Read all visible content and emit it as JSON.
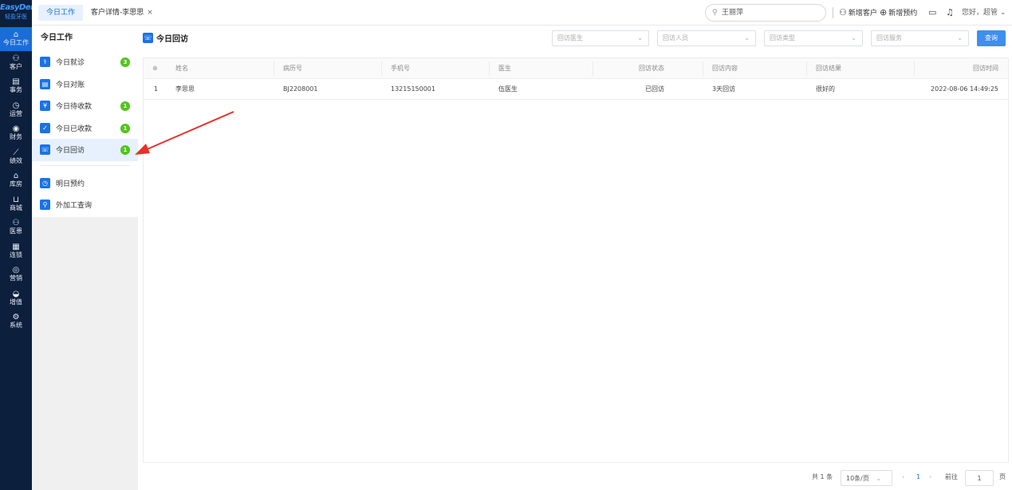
{
  "logo": {
    "brand": "EasyDent",
    "subtitle": "轻盈牙医"
  },
  "nav": [
    {
      "label": "今日工作",
      "icon": "⌂",
      "name": "home-icon",
      "active": true
    },
    {
      "label": "客户",
      "icon": "⚇",
      "name": "person-icon"
    },
    {
      "label": "事务",
      "icon": "▤",
      "name": "task-icon"
    },
    {
      "label": "运营",
      "icon": "◷",
      "name": "clock-icon"
    },
    {
      "label": "财务",
      "icon": "◉",
      "name": "money-icon"
    },
    {
      "label": "绩效",
      "icon": "⟋",
      "name": "chart-icon"
    },
    {
      "label": "库房",
      "icon": "⌂",
      "name": "warehouse-icon"
    },
    {
      "label": "商城",
      "icon": "⊔",
      "name": "cart-icon"
    },
    {
      "label": "医患",
      "icon": "⚇",
      "name": "doctor-patient-icon"
    },
    {
      "label": "连锁",
      "icon": "▦",
      "name": "chain-icon"
    },
    {
      "label": "营销",
      "icon": "◎",
      "name": "marketing-icon"
    },
    {
      "label": "增值",
      "icon": "◒",
      "name": "value-added-icon"
    },
    {
      "label": "系统",
      "icon": "⚙",
      "name": "gear-icon"
    }
  ],
  "topbar": {
    "tabs": [
      {
        "label": "今日工作"
      },
      {
        "label": "客户详情-李思思",
        "close": "×"
      }
    ],
    "search_value": "王丽萍",
    "actions": {
      "new_customer": "新增客户",
      "new_appointment": "新增预约",
      "greeting": "您好，超管"
    }
  },
  "submenu": {
    "title": "今日工作",
    "items": [
      {
        "label": "今日就诊",
        "badge": "3",
        "icon": "⚕",
        "name": "visit-icon"
      },
      {
        "label": "今日对账",
        "badge": "",
        "icon": "▤",
        "name": "ledger-icon"
      },
      {
        "label": "今日待收款",
        "badge": "1",
        "icon": "¥",
        "name": "pending-payment-icon"
      },
      {
        "label": "今日已收款",
        "badge": "1",
        "icon": "✓",
        "name": "received-payment-icon"
      },
      {
        "label": "今日回访",
        "badge": "1",
        "icon": "☏",
        "name": "follow-up-icon",
        "active": true
      }
    ],
    "items2": [
      {
        "label": "明日预约",
        "icon": "◷",
        "name": "appointment-icon"
      },
      {
        "label": "外加工查询",
        "icon": "⚲",
        "name": "outsourcing-icon"
      }
    ]
  },
  "main": {
    "title": "今日回访",
    "filters": {
      "doctor": "回访医生",
      "staff": "回访人员",
      "type": "回访类型",
      "service": "回访服务"
    },
    "query_label": "查询",
    "table": {
      "header_icon": "⊕",
      "columns": [
        "姓名",
        "病历号",
        "手机号",
        "医生",
        "回访状态",
        "回访内容",
        "回访结果",
        "回访时间"
      ],
      "rows": [
        {
          "index": "1",
          "name": "李思思",
          "record": "BJ2208001",
          "phone": "13215150001",
          "doctor": "伍医生",
          "status": "已回访",
          "content": "3天回访",
          "result": "很好的",
          "time": "2022-08-06 14:49:25"
        }
      ]
    },
    "pager": {
      "total": "共 1 条",
      "page_size": "10条/页",
      "prev": "‹",
      "current": "1",
      "next": "›",
      "goto_label": "前往",
      "goto_value": "1",
      "page_suffix": "页"
    }
  },
  "colors": {
    "nav_bg": "#0c1f3d",
    "accent": "#1a73e8",
    "badge": "#52c41a",
    "arrow": "#e8312a"
  }
}
